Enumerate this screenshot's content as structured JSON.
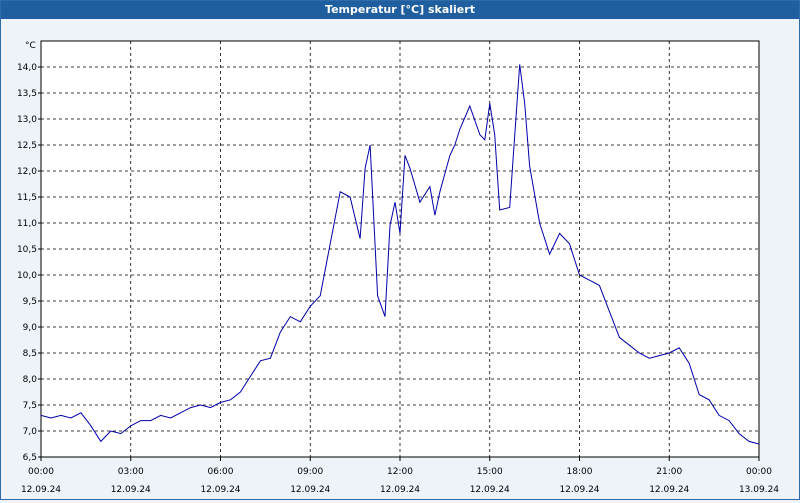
{
  "window": {
    "title": "Temperatur [°C] skaliert"
  },
  "chart_data": {
    "type": "line",
    "title": "Temperatur [°C] skaliert",
    "ylabel": "°C",
    "xlabel": "",
    "ylim": [
      6.5,
      14.5
    ],
    "grid": true,
    "legend": "none",
    "line_color": "#0000aa",
    "y_ticks": [
      "6,5",
      "7,0",
      "7,5",
      "8,0",
      "8,5",
      "9,0",
      "9,5",
      "10,0",
      "10,5",
      "11,0",
      "11,5",
      "12,0",
      "12,5",
      "13,0",
      "13,5",
      "14,0"
    ],
    "x_ticks": [
      {
        "time": "00:00",
        "date": "12.09.24"
      },
      {
        "time": "03:00",
        "date": "12.09.24"
      },
      {
        "time": "06:00",
        "date": "12.09.24"
      },
      {
        "time": "09:00",
        "date": "12.09.24"
      },
      {
        "time": "12:00",
        "date": "12.09.24"
      },
      {
        "time": "15:00",
        "date": "12.09.24"
      },
      {
        "time": "18:00",
        "date": "12.09.24"
      },
      {
        "time": "21:00",
        "date": "12.09.24"
      },
      {
        "time": "00:00",
        "date": "13.09.24"
      }
    ],
    "series": [
      {
        "x": [
          "00:00",
          "00:20",
          "00:40",
          "01:00",
          "01:20",
          "01:40",
          "02:00",
          "02:20",
          "02:40",
          "03:00",
          "03:20",
          "03:40",
          "04:00",
          "04:20",
          "04:40",
          "05:00",
          "05:20",
          "05:40",
          "06:00",
          "06:20",
          "06:40",
          "07:00",
          "07:20",
          "07:40",
          "08:00",
          "08:20",
          "08:40",
          "09:00",
          "09:10",
          "09:20",
          "09:40",
          "10:00",
          "10:20",
          "10:40",
          "10:50",
          "11:00",
          "11:15",
          "11:30",
          "11:40",
          "11:50",
          "12:00",
          "12:10",
          "12:20",
          "12:40",
          "13:00",
          "13:10",
          "13:20",
          "13:40",
          "13:50",
          "14:00",
          "14:20",
          "14:40",
          "14:50",
          "15:00",
          "15:10",
          "15:20",
          "15:40",
          "16:00",
          "16:10",
          "16:20",
          "16:40",
          "17:00",
          "17:20",
          "17:40",
          "18:00",
          "18:20",
          "18:40",
          "19:00",
          "19:20",
          "19:40",
          "20:00",
          "20:20",
          "20:40",
          "21:00",
          "21:20",
          "21:40",
          "22:00",
          "22:20",
          "22:40",
          "23:00",
          "23:20",
          "23:40",
          "24:00"
        ],
        "y": [
          7.3,
          7.25,
          7.3,
          7.25,
          7.35,
          7.1,
          6.8,
          7.0,
          6.95,
          7.1,
          7.2,
          7.2,
          7.3,
          7.25,
          7.35,
          7.45,
          7.5,
          7.45,
          7.55,
          7.6,
          7.75,
          8.05,
          8.35,
          8.4,
          8.9,
          9.2,
          9.1,
          9.4,
          9.5,
          9.6,
          10.6,
          11.6,
          11.5,
          10.7,
          12.05,
          12.5,
          9.6,
          9.2,
          10.95,
          11.4,
          10.8,
          12.3,
          12.05,
          11.4,
          11.7,
          11.15,
          11.6,
          12.3,
          12.5,
          12.8,
          13.25,
          12.7,
          12.6,
          13.3,
          12.7,
          11.25,
          11.3,
          14.05,
          13.3,
          12.1,
          11.0,
          10.4,
          10.8,
          10.6,
          10.0,
          9.9,
          9.8,
          9.3,
          8.8,
          8.65,
          8.5,
          8.4,
          8.45,
          8.5,
          8.6,
          8.3,
          7.7,
          7.6,
          7.3,
          7.2,
          6.95,
          6.8,
          6.75
        ]
      }
    ]
  }
}
